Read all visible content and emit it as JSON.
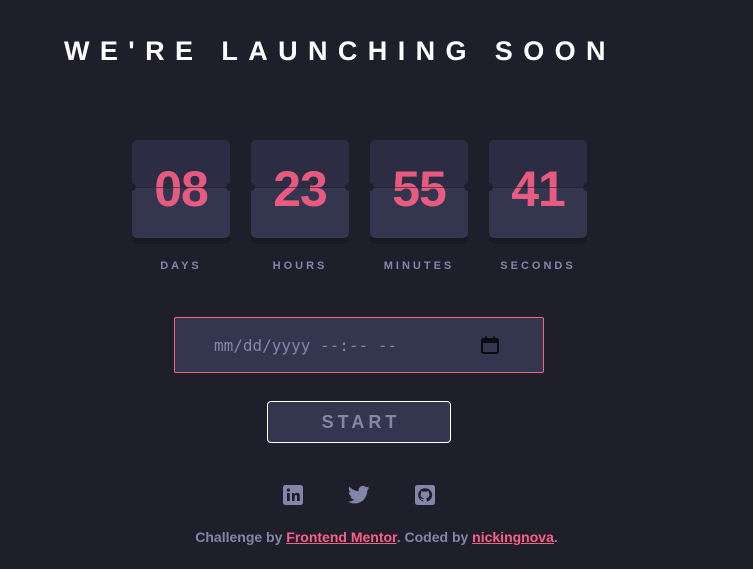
{
  "page": {
    "title": "WE'RE LAUNCHING SOON"
  },
  "countdown": [
    {
      "value": "08",
      "label": "DAYS"
    },
    {
      "value": "23",
      "label": "HOURS"
    },
    {
      "value": "55",
      "label": "MINUTES"
    },
    {
      "value": "41",
      "label": "SECONDS"
    }
  ],
  "date_input": {
    "placeholder": "mm/dd/yyyy --:-- --",
    "value": "",
    "icon": "calendar-icon"
  },
  "start_button": {
    "label": "START"
  },
  "social": [
    {
      "icon": "linkedin-icon"
    },
    {
      "icon": "twitter-icon"
    },
    {
      "icon": "github-icon"
    }
  ],
  "attribution": {
    "prefix": "Challenge by ",
    "link1": "Frontend Mentor",
    "middle": ". Coded by ",
    "link2": "nickingnova",
    "suffix": "."
  },
  "colors": {
    "background": "#1f1f2c",
    "card_bottom": "#343650",
    "card_top": "#2c2c44",
    "accent": "#fb6087",
    "muted": "#8486a9",
    "title": "#ffffff"
  }
}
